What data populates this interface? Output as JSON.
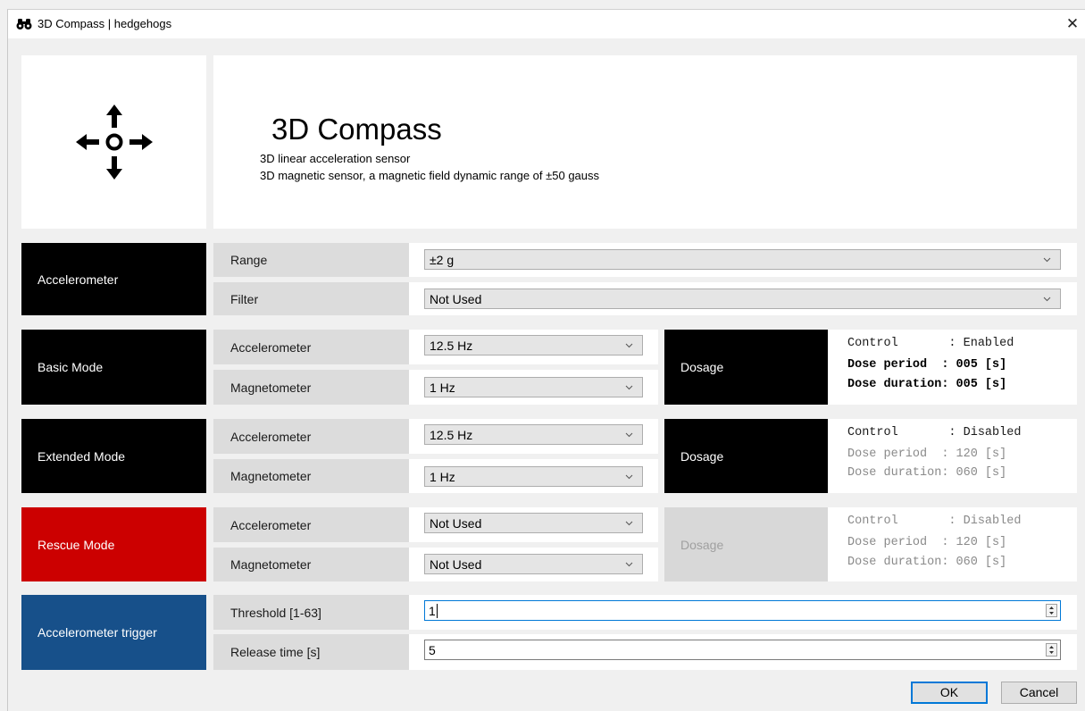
{
  "window": {
    "title": "3D Compass | hedgehogs",
    "close_glyph": "✕",
    "app_icon": "binoculars-icon"
  },
  "header": {
    "icon": "move-arrows-icon",
    "title": "3D Compass",
    "lines": [
      "3D linear acceleration sensor",
      "3D magnetic sensor, a magnetic field dynamic range of ±50 gauss"
    ]
  },
  "accelerometer": {
    "label": "Accelerometer",
    "range_label": "Range",
    "range_value": "±2 g",
    "filter_label": "Filter",
    "filter_value": "Not Used"
  },
  "basic_mode": {
    "label": "Basic Mode",
    "accel_label": "Accelerometer",
    "accel_value": "12.5 Hz",
    "magnet_label": "Magnetometer",
    "magnet_value": "1 Hz",
    "dosage_label": "Dosage",
    "dosage_lines": [
      "Control       : Enabled",
      "Dose period  : 005 [s]",
      "Dose duration: 005 [s]"
    ],
    "dosage_enabled": true
  },
  "extended_mode": {
    "label": "Extended Mode",
    "accel_label": "Accelerometer",
    "accel_value": "12.5 Hz",
    "magnet_label": "Magnetometer",
    "magnet_value": "1 Hz",
    "dosage_label": "Dosage",
    "dosage_lines": [
      "Control       : Disabled",
      "Dose period  : 120 [s]",
      "Dose duration: 060 [s]"
    ],
    "dosage_enabled": false
  },
  "rescue_mode": {
    "label": "Rescue Mode",
    "accel_label": "Accelerometer",
    "accel_value": "Not Used",
    "magnet_label": "Magnetometer",
    "magnet_value": "Not Used",
    "dosage_label": "Dosage",
    "dosage_lines": [
      "Control       : Disabled",
      "Dose period  : 120 [s]",
      "Dose duration: 060 [s]"
    ],
    "dosage_enabled": false
  },
  "trigger": {
    "label": "Accelerometer trigger",
    "threshold_label": "Threshold [1-63]",
    "threshold_value": "1",
    "release_label": "Release time [s]",
    "release_value": "5"
  },
  "buttons": {
    "ok": "OK",
    "cancel": "Cancel"
  },
  "colors": {
    "black_block": "#000000",
    "rescue_block": "#cc0000",
    "trigger_block": "#17508a",
    "focus": "#0078d7"
  }
}
